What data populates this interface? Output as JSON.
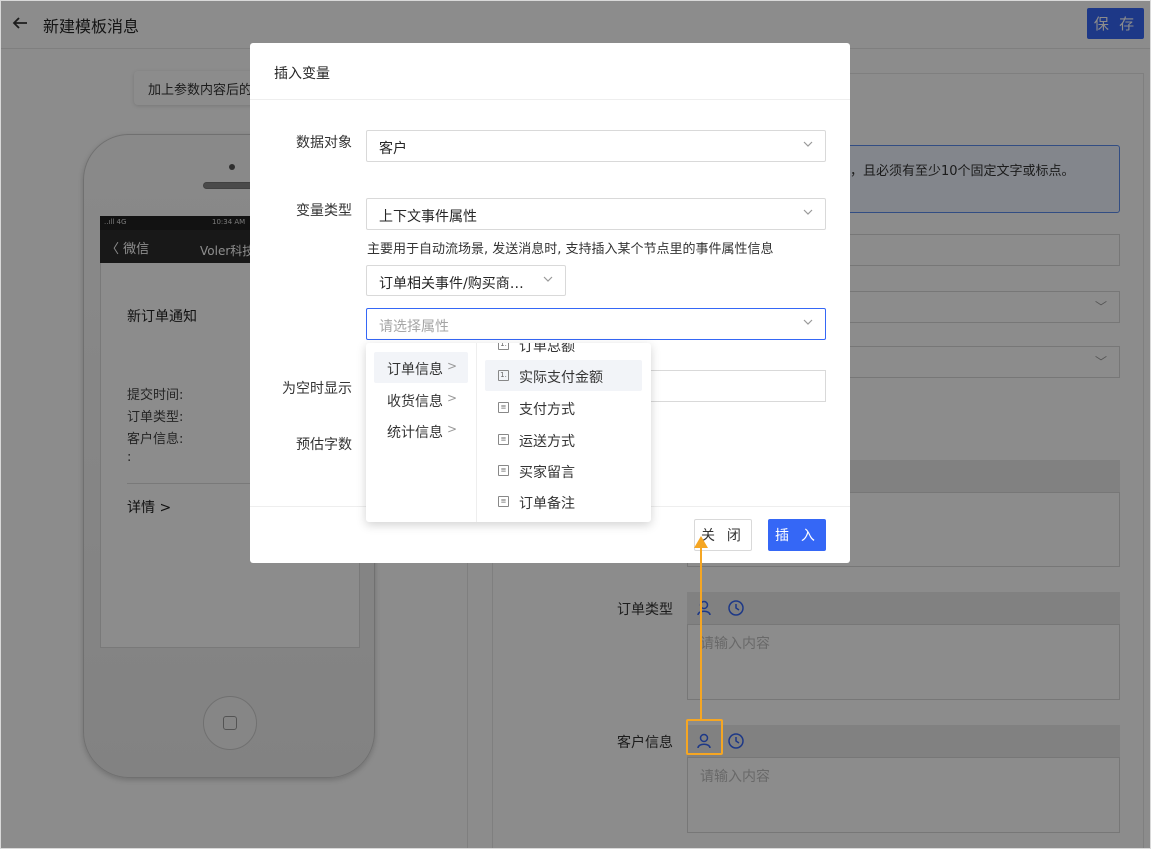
{
  "header": {
    "title": "新建模板消息",
    "save_label": "保 存"
  },
  "phone": {
    "tip": "加上参数内容后的",
    "status_left": "..ıll 4G",
    "status_time": "10:34 AM",
    "back_label": "〈 微信",
    "account": "Voler科技",
    "msg_title": "新订单通知",
    "lines": [
      "提交时间:",
      "订单类型:",
      "客户信息:",
      ":"
    ],
    "detail_label": "详情 >"
  },
  "form": {
    "info_text": "，且必须有至少10个固定文字或标点。",
    "fields": [
      {
        "label": "订单类型",
        "placeholder": "请输入内容"
      },
      {
        "label": "客户信息",
        "placeholder": "请输入内容"
      }
    ]
  },
  "modal": {
    "title": "插入变量",
    "data_object_label": "数据对象",
    "data_object_value": "客户",
    "var_type_label": "变量类型",
    "var_type_value": "上下文事件属性",
    "hint": "主要用于自动流场景, 发送消息时, 支持插入某个节点里的事件属性信息",
    "event_select": "订单相关事件/购买商…",
    "attr_placeholder": "请选择属性",
    "empty_label": "为空时显示",
    "count_label": "预估字数",
    "close_label": "关 闭",
    "insert_label": "插 入"
  },
  "cascader": {
    "level1": [
      {
        "label": "订单信息",
        "active": true
      },
      {
        "label": "收货信息",
        "active": false
      },
      {
        "label": "统计信息",
        "active": false
      }
    ],
    "level2": [
      {
        "label": "订单总额",
        "active": false
      },
      {
        "label": "实际支付金额",
        "active": true
      },
      {
        "label": "支付方式",
        "active": false
      },
      {
        "label": "运送方式",
        "active": false
      },
      {
        "label": "买家留言",
        "active": false
      },
      {
        "label": "订单备注",
        "active": false
      }
    ]
  },
  "colors": {
    "primary": "#3567f6",
    "highlight": "#f5a623"
  }
}
